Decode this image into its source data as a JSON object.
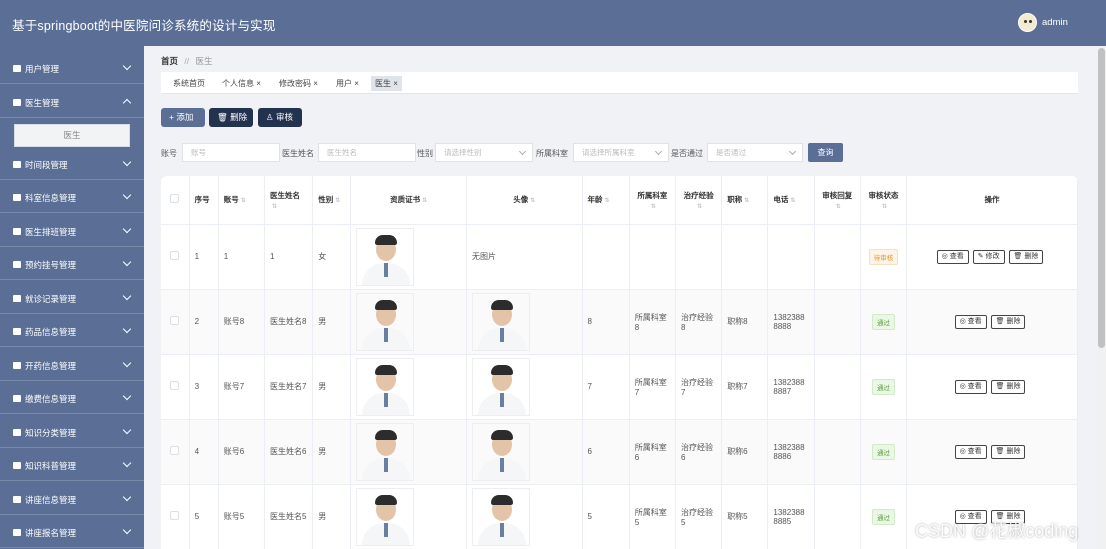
{
  "header": {
    "title": "基于springboot的中医院问诊系统的设计与实现",
    "user": "admin"
  },
  "sidebar": {
    "items": [
      {
        "label": "用户管理",
        "expanded": false
      },
      {
        "label": "医生管理",
        "expanded": true
      },
      {
        "label": "时间段管理",
        "expanded": false
      },
      {
        "label": "科室信息管理",
        "expanded": false
      },
      {
        "label": "医生排班管理",
        "expanded": false
      },
      {
        "label": "预约挂号管理",
        "expanded": false
      },
      {
        "label": "就诊记录管理",
        "expanded": false
      },
      {
        "label": "药品信息管理",
        "expanded": false
      },
      {
        "label": "开药信息管理",
        "expanded": false
      },
      {
        "label": "缴费信息管理",
        "expanded": false
      },
      {
        "label": "知识分类管理",
        "expanded": false
      },
      {
        "label": "知识科普管理",
        "expanded": false
      },
      {
        "label": "讲座信息管理",
        "expanded": false
      },
      {
        "label": "讲座报名管理",
        "expanded": false
      }
    ],
    "submenu_active": "医生"
  },
  "breadcrumb": {
    "home": "首页",
    "separator": "//",
    "current": "医生"
  },
  "tags": [
    "系统首页",
    "个人信息 ×",
    "修改密码 ×",
    "用户 ×",
    "医生 ×"
  ],
  "actions": {
    "add": "+ 添加",
    "delete": "🗑 删除",
    "audit": "♙ 审核"
  },
  "search": {
    "account_label": "账号",
    "account_placeholder": "账号",
    "name_label": "医生姓名",
    "name_placeholder": "医生姓名",
    "gender_label": "性别",
    "gender_placeholder": "请选择性别",
    "dept_label": "所属科室",
    "dept_placeholder": "请选择所属科室",
    "pass_label": "是否通过",
    "pass_placeholder": "是否通过",
    "button": "查询"
  },
  "table": {
    "columns": [
      "序号",
      "账号",
      "医生姓名",
      "性别",
      "资质证书",
      "头像",
      "年龄",
      "所属科室",
      "治疗经验",
      "职称",
      "电话",
      "审核回复",
      "审核状态",
      "操作"
    ],
    "rows": [
      {
        "index": "1",
        "account": "1",
        "name": "1",
        "gender": "女",
        "avatar_text": "无图片",
        "age": "",
        "dept": "",
        "experience": "",
        "title": "",
        "phone": "",
        "reply": "",
        "status": "待审核",
        "status_type": "pending",
        "ops": [
          "◎ 查看",
          "✎ 修改",
          "🗑 删除"
        ]
      },
      {
        "index": "2",
        "account": "账号8",
        "name": "医生姓名8",
        "gender": "男",
        "avatar_text": "",
        "age": "8",
        "dept": "所属科室8",
        "experience": "治疗经验8",
        "title": "职称8",
        "phone": "13823888888",
        "reply": "",
        "status": "通过",
        "status_type": "pass",
        "ops": [
          "◎ 查看",
          "🗑 删除"
        ]
      },
      {
        "index": "3",
        "account": "账号7",
        "name": "医生姓名7",
        "gender": "男",
        "avatar_text": "",
        "age": "7",
        "dept": "所属科室7",
        "experience": "治疗经验7",
        "title": "职称7",
        "phone": "13823888887",
        "reply": "",
        "status": "通过",
        "status_type": "pass",
        "ops": [
          "◎ 查看",
          "🗑 删除"
        ]
      },
      {
        "index": "4",
        "account": "账号6",
        "name": "医生姓名6",
        "gender": "男",
        "avatar_text": "",
        "age": "6",
        "dept": "所属科室6",
        "experience": "治疗经验6",
        "title": "职称6",
        "phone": "13823888886",
        "reply": "",
        "status": "通过",
        "status_type": "pass",
        "ops": [
          "◎ 查看",
          "🗑 删除"
        ]
      },
      {
        "index": "5",
        "account": "账号5",
        "name": "医生姓名5",
        "gender": "男",
        "avatar_text": "",
        "age": "5",
        "dept": "所属科室5",
        "experience": "治疗经验5",
        "title": "职称5",
        "phone": "13823888885",
        "reply": "",
        "status": "通过",
        "status_type": "pass",
        "ops": [
          "◎ 查看",
          "🗑 删除"
        ]
      }
    ]
  },
  "watermark": "CSDN @花椒coding",
  "colors": {
    "primary": "#5b6f96",
    "dark": "#23324e",
    "pass": "#5c9d3b",
    "pending": "#e39a3a"
  }
}
